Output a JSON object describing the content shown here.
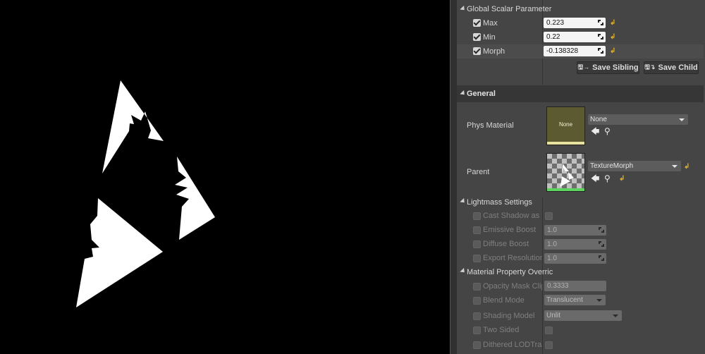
{
  "global_scalar": {
    "title": "Global Scalar Parameter",
    "params": [
      {
        "label": "Max",
        "value": "0.223"
      },
      {
        "label": "Min",
        "value": "0.22"
      },
      {
        "label": "Morph",
        "value": "-0.138328"
      }
    ],
    "save_sibling": "Save Sibling",
    "save_child": "Save Child"
  },
  "general": {
    "title": "General",
    "phys_material_label": "Phys Material",
    "phys_material_value": "None",
    "phys_thumb_text": "None",
    "parent_label": "Parent",
    "parent_value": "TextureMorph"
  },
  "lightmass": {
    "title": "Lightmass Settings",
    "cast_shadow": "Cast Shadow as Ma",
    "emissive_boost": "Emissive Boost",
    "emissive_boost_value": "1.0",
    "diffuse_boost": "Diffuse Boost",
    "diffuse_boost_value": "1.0",
    "export_resolution": "Export Resolution Sc",
    "export_resolution_value": "1.0"
  },
  "material_override": {
    "title": "Material Property Overric",
    "opacity_mask": "Opacity Mask Clip V",
    "opacity_mask_value": "0.3333",
    "blend_mode": "Blend Mode",
    "blend_mode_value": "Translucent",
    "shading_model": "Shading Model",
    "shading_model_value": "Unlit",
    "two_sided": "Two Sided",
    "dithered": "Dithered LODTransit"
  },
  "colors": {
    "panel_bg": "#454545",
    "header_bg": "#363636",
    "reset_arrow": "#e5b428",
    "thumb_bar": "#e8e2a0",
    "parent_bar": "#5fd35f"
  }
}
